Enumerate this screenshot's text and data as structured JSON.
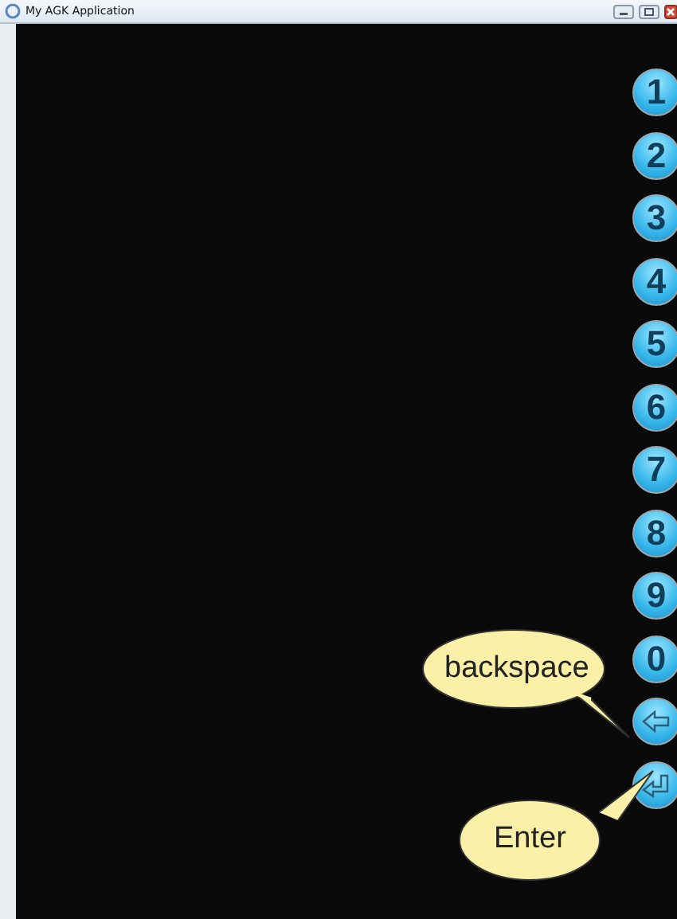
{
  "window": {
    "title": "My AGK Application"
  },
  "keys": [
    {
      "kind": "digit",
      "label": "1"
    },
    {
      "kind": "digit",
      "label": "2"
    },
    {
      "kind": "digit",
      "label": "3"
    },
    {
      "kind": "digit",
      "label": "4"
    },
    {
      "kind": "digit",
      "label": "5"
    },
    {
      "kind": "digit",
      "label": "6"
    },
    {
      "kind": "digit",
      "label": "7"
    },
    {
      "kind": "digit",
      "label": "8"
    },
    {
      "kind": "digit",
      "label": "9"
    },
    {
      "kind": "digit",
      "label": "0"
    },
    {
      "kind": "backspace"
    },
    {
      "kind": "enter"
    }
  ],
  "callouts": [
    {
      "text": "backspace",
      "kind": "above"
    },
    {
      "text": "Enter",
      "kind": "below"
    }
  ]
}
